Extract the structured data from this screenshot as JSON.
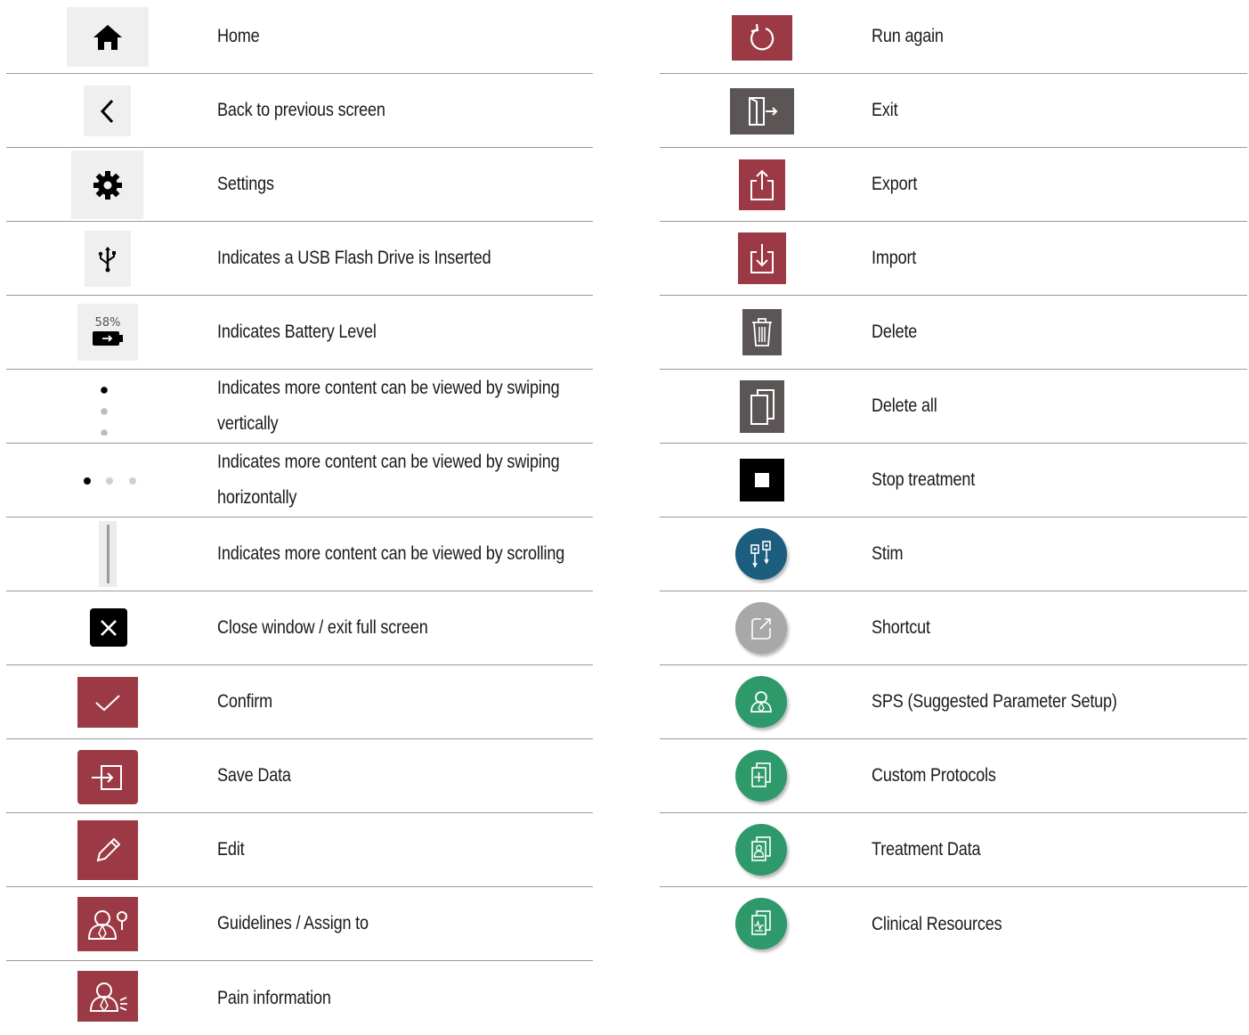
{
  "left_rows": [
    {
      "label": "Home",
      "icon": "home-icon"
    },
    {
      "label": "Back to previous screen",
      "icon": "chevron-left-icon"
    },
    {
      "label": "Settings",
      "icon": "gear-icon"
    },
    {
      "label": "Indicates a USB Flash Drive is Inserted",
      "icon": "usb-icon"
    },
    {
      "label": "Indicates Battery Level",
      "icon": "battery-icon",
      "battery_percent": "58%"
    },
    {
      "label": "Indicates more content can be viewed by swiping vertically",
      "icon": "vertical-dots-icon"
    },
    {
      "label": "Indicates more content can be viewed by swiping horizontally",
      "icon": "horizontal-dots-icon"
    },
    {
      "label": "Indicates more content can be viewed by scrolling",
      "icon": "scrollbar-icon"
    },
    {
      "label": "Close window / exit full screen",
      "icon": "close-icon"
    },
    {
      "label": "Confirm",
      "icon": "checkmark-icon"
    },
    {
      "label": "Save Data",
      "icon": "save-icon"
    },
    {
      "label": "Edit",
      "icon": "pencil-icon"
    },
    {
      "label": "Guidelines / Assign to",
      "icon": "assign-icon"
    },
    {
      "label": "Pain information",
      "icon": "pain-info-icon"
    }
  ],
  "right_rows": [
    {
      "label": "Run again",
      "icon": "refresh-icon"
    },
    {
      "label": "Exit",
      "icon": "exit-door-icon"
    },
    {
      "label": "Export",
      "icon": "export-icon"
    },
    {
      "label": "Import",
      "icon": "import-icon"
    },
    {
      "label": "Delete",
      "icon": "trash-icon"
    },
    {
      "label": "Delete all",
      "icon": "delete-all-icon"
    },
    {
      "label": "Stop treatment",
      "icon": "stop-icon"
    },
    {
      "label": "Stim",
      "icon": "stim-icon"
    },
    {
      "label": "Shortcut",
      "icon": "shortcut-icon"
    },
    {
      "label": "SPS (Suggested Parameter Setup)",
      "icon": "sps-icon"
    },
    {
      "label": "Custom Protocols",
      "icon": "custom-protocols-icon"
    },
    {
      "label": "Treatment Data",
      "icon": "treatment-data-icon"
    },
    {
      "label": "Clinical Resources",
      "icon": "clinical-resources-icon"
    }
  ],
  "colors": {
    "red": "#9b3a45",
    "dark_grey": "#5c5556",
    "light_grey": "#efefef",
    "blue": "#1d5d7e",
    "green": "#2e9a6c",
    "shortcut_grey": "#a8a8a8"
  }
}
